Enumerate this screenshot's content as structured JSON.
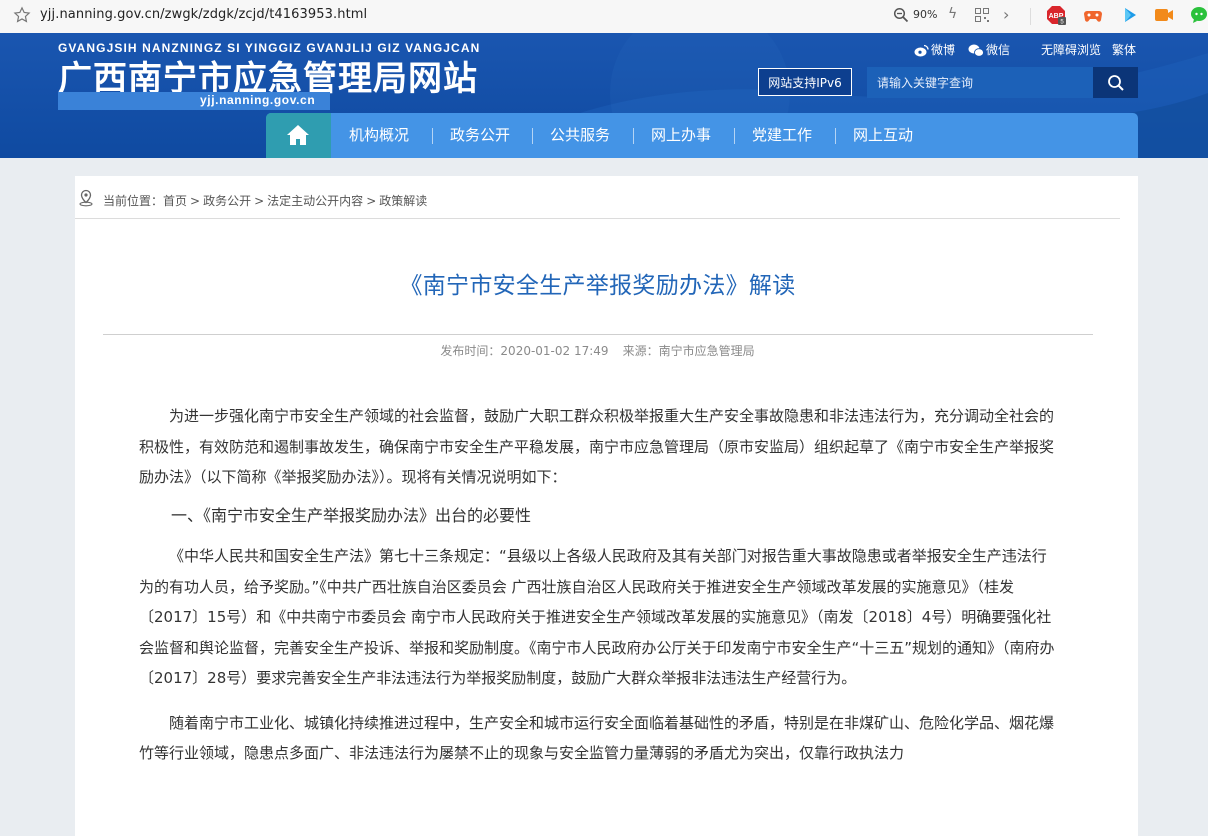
{
  "browser": {
    "url": "yjj.nanning.gov.cn/zwgk/zdgk/zcjd/t4163953.html",
    "zoom": "90%",
    "icons": [
      "star-icon",
      "zoom-icon",
      "bolt-icon",
      "qr-code-icon",
      "next-icon",
      "abp-extension-icon",
      "game-extension-icon",
      "play-extension-icon",
      "video-extension-icon",
      "wechat-extension-icon"
    ]
  },
  "header": {
    "pinyin": "GVANGJSIH NANZNINGZ SI YINGGIZ GVANJLIJ GIZ VANGJCAN",
    "site_name": "广西南宁市应急管理局网站",
    "domain": "yjj.nanning.gov.cn",
    "links": {
      "weibo": "微博",
      "weixin": "微信",
      "accessibility": "无障碍浏览",
      "traditional": "繁体"
    },
    "ipv6": "网站支持IPv6",
    "search_placeholder": "请输入关键字查询",
    "colors": {
      "header_bg": "#1452ab",
      "nav_bg": "#4494e6",
      "home_bg": "#2f9db0",
      "search_button_bg": "#0b3578"
    }
  },
  "nav": {
    "items": [
      "机构概况",
      "政务公开",
      "公共服务",
      "网上办事",
      "党建工作",
      "网上互动"
    ]
  },
  "breadcrumb": {
    "label": "当前位置：",
    "items": [
      "首页",
      "政务公开",
      "法定主动公开内容",
      "政策解读"
    ],
    "separator": ">"
  },
  "article": {
    "title": "《南宁市安全生产举报奖励办法》解读",
    "meta_time": "发布时间：2020-01-02 17:49",
    "meta_source": "来源：南宁市应急管理局",
    "title_color": "#2266b8",
    "paragraphs": [
      "为进一步强化南宁市安全生产领域的社会监督，鼓励广大职工群众积极举报重大生产安全事故隐患和非法违法行为，充分调动全社会的积极性，有效防范和遏制事故发生，确保南宁市安全生产平稳发展，南宁市应急管理局（原市安监局）组织起草了《南宁市安全生产举报奖励办法》（以下简称《举报奖励办法》）。现将有关情况说明如下：",
      "一、《南宁市安全生产举报奖励办法》出台的必要性",
      "《中华人民共和国安全生产法》第七十三条规定：“县级以上各级人民政府及其有关部门对报告重大事故隐患或者举报安全生产违法行为的有功人员，给予奖励。”《中共广西壮族自治区委员会 广西壮族自治区人民政府关于推进安全生产领域改革发展的实施意见》（桂发〔2017〕15号）和《中共南宁市委员会 南宁市人民政府关于推进安全生产领域改革发展的实施意见》（南发〔2018〕4号）明确要强化社会监督和舆论监督，完善安全生产投诉、举报和奖励制度。《南宁市人民政府办公厅关于印发南宁市安全生产“十三五”规划的通知》（南府办〔2017〕28号）要求完善安全生产非法违法行为举报奖励制度，鼓励广大群众举报非法违法生产经营行为。",
      "随着南宁市工业化、城镇化持续推进过程中，生产安全和城市运行安全面临着基础性的矛盾，特别是在非煤矿山、危险化学品、烟花爆竹等行业领域，隐患点多面广、非法违法行为屡禁不止的现象与安全监管力量薄弱的矛盾尤为突出，仅靠行政执法力"
    ]
  }
}
